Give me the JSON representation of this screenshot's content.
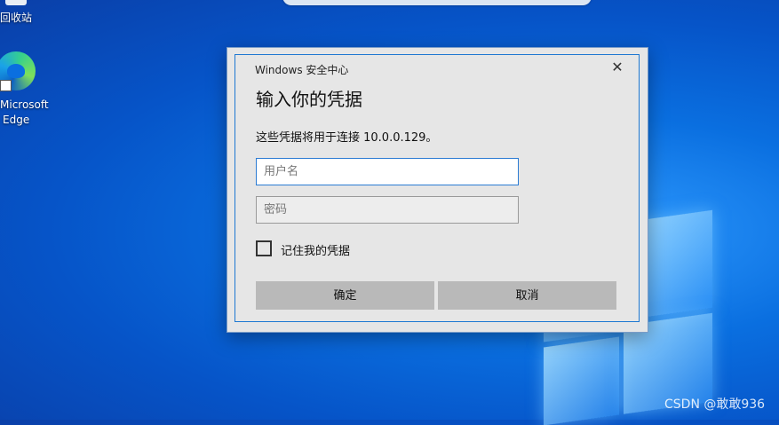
{
  "desktop": {
    "icons": [
      {
        "label": "回收站"
      },
      {
        "label_line1": "Microsoft",
        "label_line2": "Edge"
      }
    ]
  },
  "dialog": {
    "window_title": "Windows 安全中心",
    "heading": "输入你的凭据",
    "description": "这些凭据将用于连接 10.0.0.129。",
    "username_placeholder": "用户名",
    "password_placeholder": "密码",
    "remember_label": "记住我的凭据",
    "ok_label": "确定",
    "cancel_label": "取消",
    "close_glyph": "✕"
  },
  "watermark": "CSDN @敢敢936",
  "colors": {
    "accent": "#1e78d2",
    "dialog_bg": "#e6e6e6",
    "button_bg": "#b9b9b9"
  }
}
